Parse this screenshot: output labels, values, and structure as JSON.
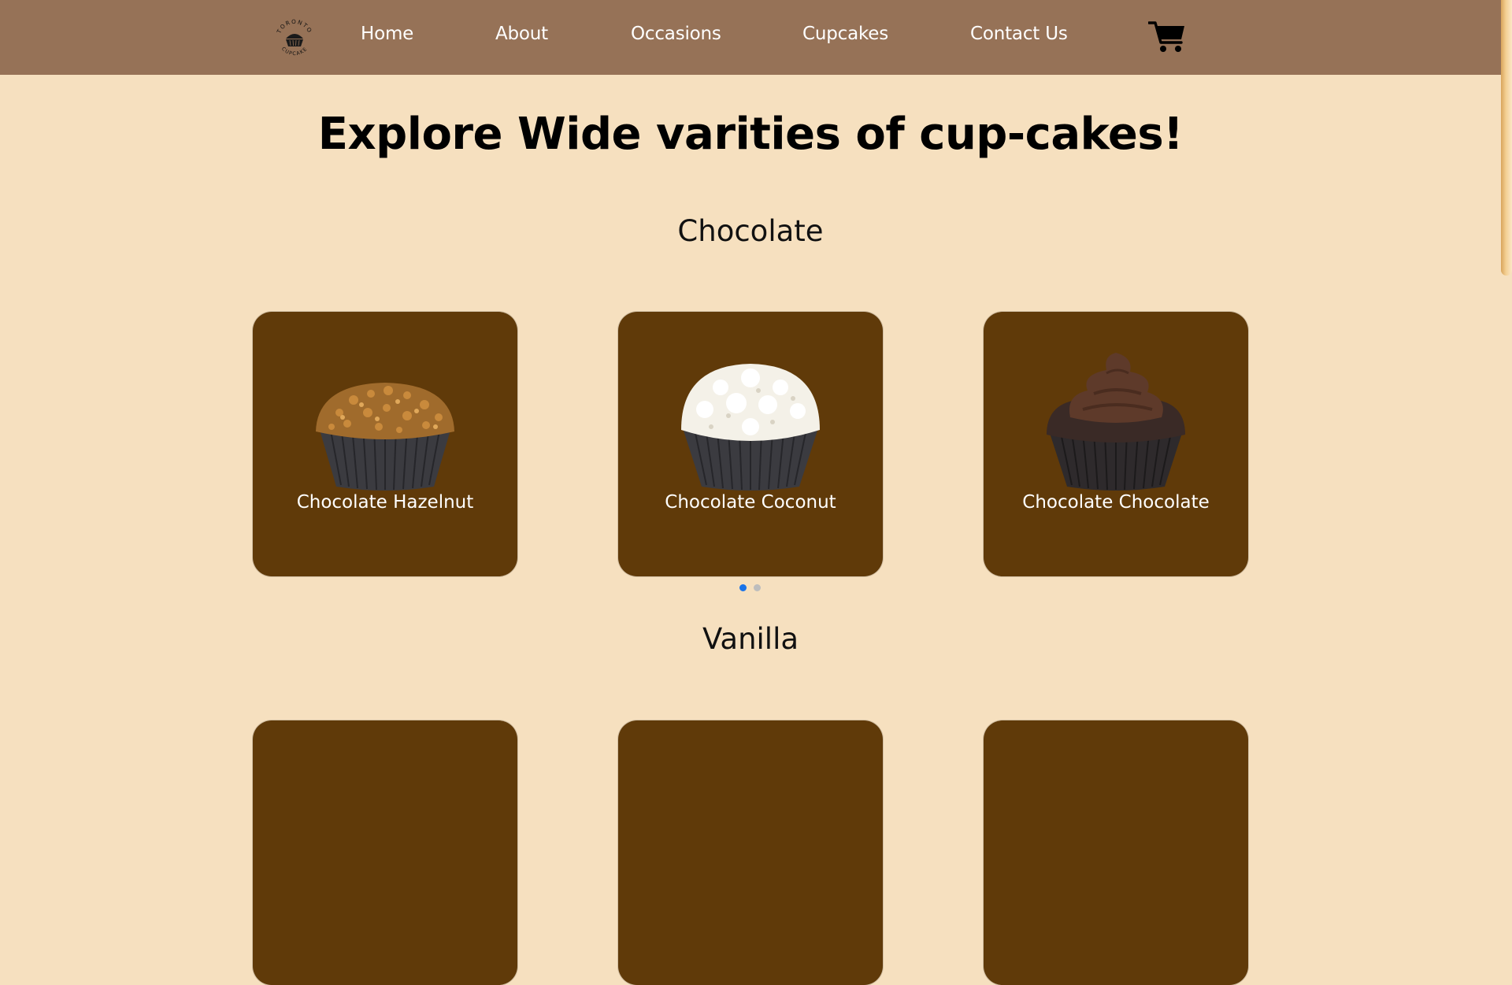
{
  "header": {
    "logo_text": "TORONTO CUPCAKE",
    "nav": [
      {
        "label": "Home"
      },
      {
        "label": "About"
      },
      {
        "label": "Occasions"
      },
      {
        "label": "Cupcakes"
      },
      {
        "label": "Contact Us"
      }
    ],
    "cart_icon": "shopping-cart-icon"
  },
  "main": {
    "title": "Explore Wide varities of cup-cakes!",
    "sections": [
      {
        "title": "Chocolate",
        "cards": [
          {
            "label": "Chocolate Hazelnut",
            "image": "hazelnut-cupcake"
          },
          {
            "label": "Chocolate Coconut",
            "image": "coconut-cupcake"
          },
          {
            "label": "Chocolate Chocolate",
            "image": "chocolate-cupcake"
          }
        ],
        "pager": {
          "pages": 2,
          "active": 1
        }
      },
      {
        "title": "Vanilla",
        "cards": [
          {},
          {},
          {}
        ]
      }
    ]
  },
  "colors": {
    "header_bg": "#967257",
    "page_bg": "#f6e0bf",
    "card_bg": "#603a09",
    "dot_active": "#1a73e8",
    "dot_inactive": "#bdbdbd"
  }
}
